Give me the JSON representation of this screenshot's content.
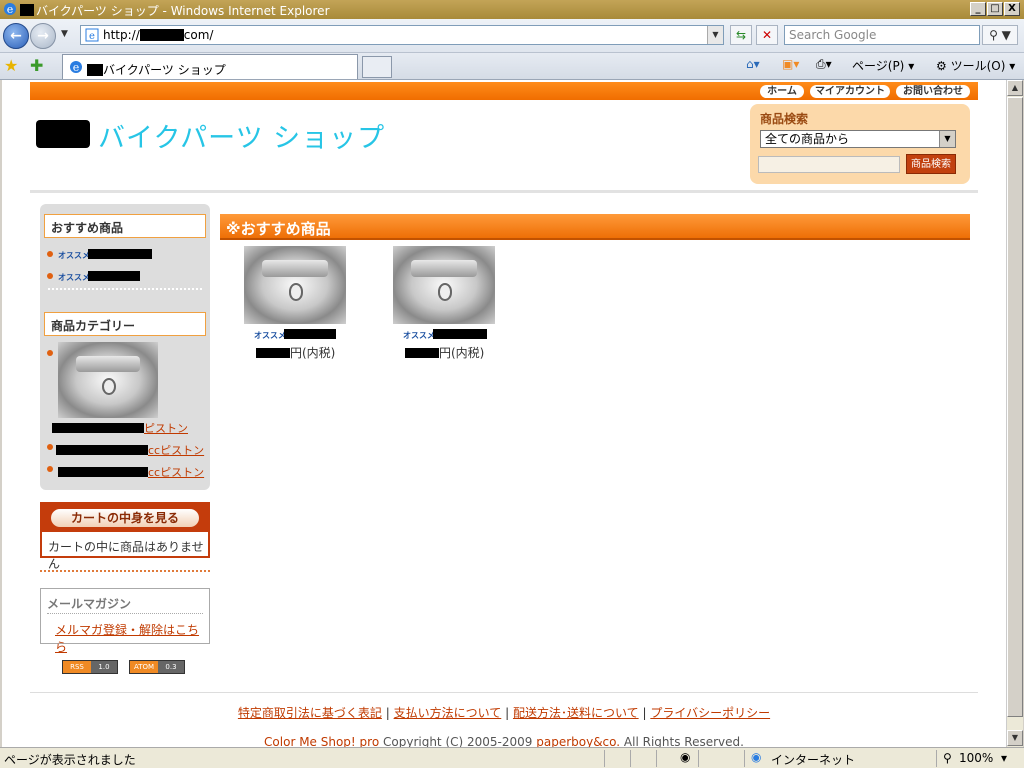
{
  "window": {
    "title": "バイクパーツ ショップ - Windows Internet Explorer",
    "buttons": {
      "minimize": "_",
      "maximize": "□",
      "close": "X"
    }
  },
  "browser": {
    "url_prefix": "http://",
    "url_suffix": "com/",
    "search_placeholder": "Search Google",
    "tab_title": "バイクパーツ ショップ",
    "commands": {
      "page": "ページ(P)",
      "tools": "ツール(O)"
    },
    "status_text": "ページが表示されました",
    "zone": "インターネット",
    "zoom": "100%"
  },
  "site": {
    "title": "バイクパーツ ショップ",
    "top_links": [
      "ホーム",
      "マイアカウント",
      "お問い合わせ"
    ],
    "search": {
      "title": "商品検索",
      "select_value": "全ての商品から",
      "button": "商品検索"
    }
  },
  "sidebar": {
    "recommend_title": "おすすめ商品",
    "osusume_tag": "オススメ",
    "recommend_items": [
      {
        "visible_text": ""
      },
      {
        "visible_text": ""
      }
    ],
    "category_title": "商品カテゴリー",
    "categories": [
      {
        "suffix": "ピストン"
      },
      {
        "suffix": "ccピストン"
      },
      {
        "suffix": "ccピストン"
      }
    ],
    "cart_button": "カートの中身を見る",
    "cart_empty": "カートの中に商品はありません",
    "mail_title": "メールマガジン",
    "mail_link": "メルマガ登録・解除はこちら",
    "feeds": [
      {
        "left": "RSS",
        "right": "1.0"
      },
      {
        "left": "ATOM",
        "right": "0.3"
      }
    ]
  },
  "main": {
    "heading": "※おすすめ商品",
    "products": [
      {
        "tag": "オススメ",
        "price_suffix": "円(内税)"
      },
      {
        "tag": "オススメ",
        "price_suffix": "円(内税)"
      }
    ]
  },
  "footer": {
    "links": [
      "特定商取引法に基づく表記",
      "支払い方法について",
      "配送方法･送料について",
      "プライバシーポリシー"
    ],
    "separator": "|",
    "brand": "Color Me Shop! pro",
    "copyright_mid": "  Copyright (C) 2005-2009 ",
    "company": "paperboy&co.",
    "copyright_end": " All Rights Reserved."
  },
  "colors": {
    "accent_orange": "#f06d00",
    "title_cyan": "#27c5e6",
    "link_red": "#c03a00",
    "cart_red": "#c43c0c"
  }
}
